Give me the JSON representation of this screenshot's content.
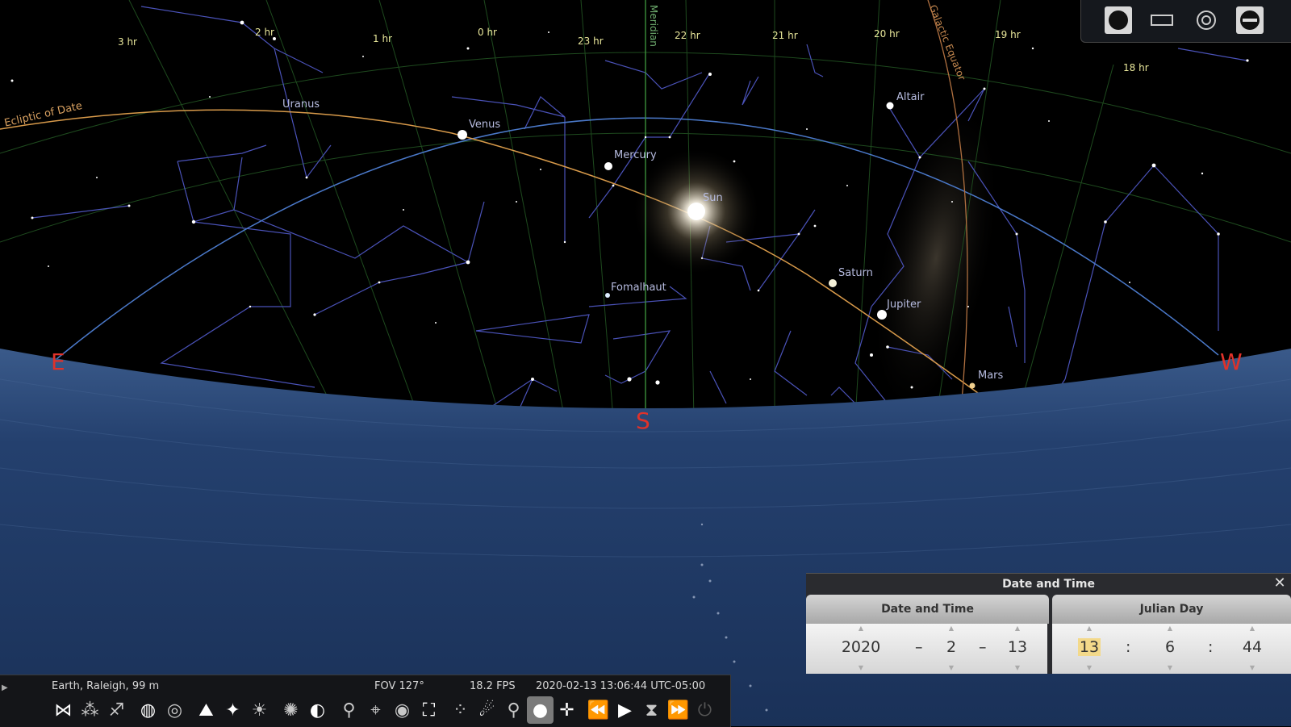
{
  "sky": {
    "ra_labels": [
      "3 hr",
      "2 hr",
      "1 hr",
      "0 hr",
      "23 hr",
      "22 hr",
      "21 hr",
      "20 hr",
      "19 hr",
      "18 hr"
    ],
    "object_labels": {
      "uranus": "Uranus",
      "venus": "Venus",
      "mercury": "Mercury",
      "sun": "Sun",
      "fomalhaut": "Fomalhaut",
      "saturn": "Saturn",
      "jupiter": "Jupiter",
      "mars": "Mars",
      "altair": "Altair"
    },
    "line_labels": {
      "meridian": "Meridian",
      "galactic_equator": "Galactic Equator",
      "ecliptic": "Ecliptic of Date"
    },
    "cardinals": {
      "east": "E",
      "south": "S",
      "west": "W"
    },
    "colors": {
      "sky": "#000000",
      "ground": "#1c3560",
      "ecliptic": "#d89a4a",
      "equator": "#4a78c8",
      "meridian": "#3f9a3f",
      "constellation": "#4a52b8",
      "cardinal": "#e0322a"
    }
  },
  "view_modes": {
    "icons": [
      "sphere-icon",
      "rectangle-icon",
      "target-icon",
      "telescope-icon"
    ]
  },
  "datetime_panel": {
    "title": "Date and Time",
    "close": "✕",
    "tab_date": "Date and Time",
    "tab_julian": "Julian Day",
    "year": "2020",
    "month": "2",
    "day": "13",
    "hour": "13",
    "minute": "6",
    "second": "44",
    "date_sep": "–",
    "time_sep": ":"
  },
  "statusbar": {
    "location": "Earth, Raleigh, 99 m",
    "fov": "FOV 127°",
    "fps": "18.2 FPS",
    "datetime": "2020-02-13 13:06:44 UTC-05:00"
  }
}
